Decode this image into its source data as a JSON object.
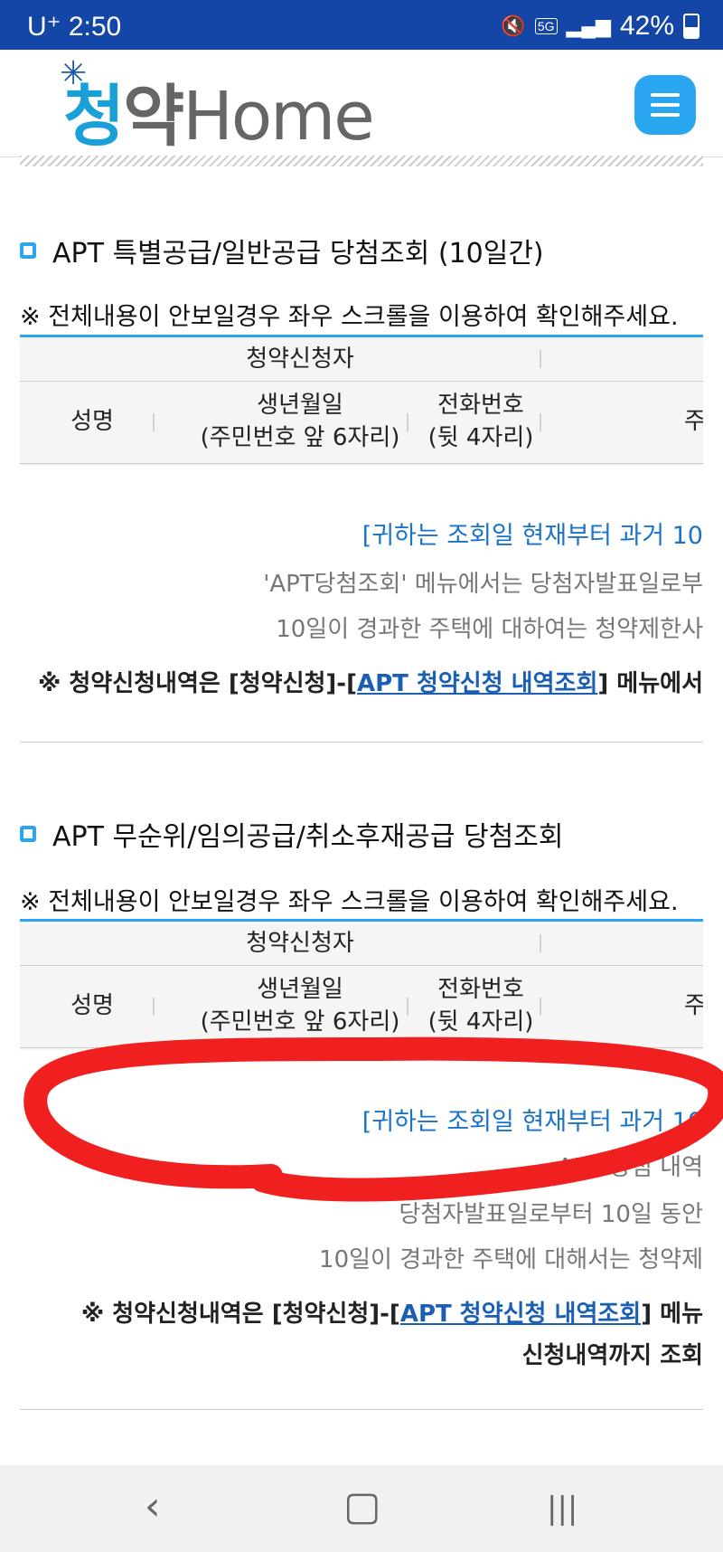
{
  "status": {
    "carrier": "U⁺ 2:50",
    "network": "5G",
    "battery": "42%"
  },
  "header": {
    "logo_part1": "청",
    "logo_part2": "약",
    "logo_part3": "Home"
  },
  "sections": [
    {
      "title": "APT 특별공급/일반공급 당첨조회 (10일간)",
      "notice": "※ 전체내용이 안보일경우 좌우 스크롤을 이용하여 확인해주세요.",
      "table": {
        "group_header": "청약신청자",
        "col_name": "성명",
        "col_birth_1": "생년월일",
        "col_birth_2": "(주민번호 앞 6자리)",
        "col_phone_1": "전화번호",
        "col_phone_2": "(뒷 4자리)",
        "col_addr": "주"
      },
      "info_blue": "[귀하는 조회일 현재부터 과거 10",
      "info_lines": [
        "'APT당첨조회' 메뉴에서는 당첨자발표일로부",
        "10일이 경과한 주택에 대하여는 청약제한사"
      ],
      "note_prefix": "※ 청약신청내역은 [청약신청]-[",
      "note_link": "APT 청약신청 내역조회",
      "note_suffix": "] 메뉴에서"
    },
    {
      "title": "APT 무순위/임의공급/취소후재공급 당첨조회",
      "notice": "※ 전체내용이 안보일경우 좌우 스크롤을 이용하여 확인해주세요.",
      "table": {
        "group_header": "청약신청자",
        "col_name": "성명",
        "col_birth_1": "생년월일",
        "col_birth_2": "(주민번호 앞 6자리)",
        "col_phone_1": "전화번호",
        "col_phone_2": "(뒷 4자리)",
        "col_addr": "주"
      },
      "info_blue": "[귀하는 조회일 현재부터 과거 10",
      "info_lines": [
        "APT 당첨 내역",
        "당첨자발표일로부터 10일 동안",
        "10일이 경과한 주택에 대해서는 청약제"
      ],
      "note_prefix": "※ 청약신청내역은 [청약신청]-[",
      "note_link": "APT 청약신청 내역조회",
      "note_suffix": "] 메뉴",
      "note_line2": "신청내역까지 조회"
    }
  ],
  "annotation": {
    "color": "#f02020"
  },
  "navbar": {
    "back": "‹",
    "home": "▢",
    "recents": "|||"
  }
}
